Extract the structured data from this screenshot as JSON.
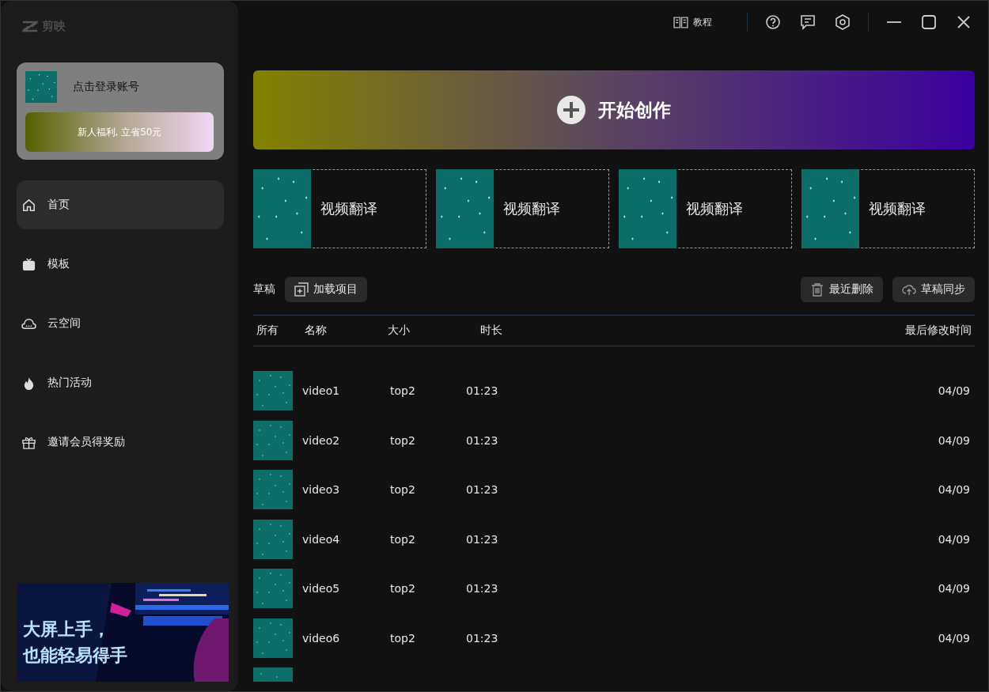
{
  "logo": {
    "text": "剪映"
  },
  "account": {
    "label": "点击登录账号",
    "promo": "新人福利, 立省50元"
  },
  "nav": [
    {
      "label": "首页",
      "selected": true
    },
    {
      "label": "模板",
      "selected": false
    },
    {
      "label": "云空间",
      "selected": false
    },
    {
      "label": "热门活动",
      "selected": false
    },
    {
      "label": "邀请会员得奖励",
      "selected": false
    }
  ],
  "banner": {
    "lines": [
      "大屏上手，",
      "也能轻易得手"
    ]
  },
  "topbar": {
    "tutorial": "教程"
  },
  "create": {
    "label": "开始创作"
  },
  "tools": [
    {
      "label": "视频翻译"
    },
    {
      "label": "视频翻译"
    },
    {
      "label": "视频翻译"
    },
    {
      "label": "视频翻译"
    }
  ],
  "drafts": {
    "title": "草稿",
    "load": "加载项目",
    "recent_deleted": "最近删除",
    "sync": "草稿同步"
  },
  "table": {
    "columns": [
      "所有",
      "名称",
      "大小",
      "时长",
      "最后修改时间"
    ],
    "rows": [
      {
        "kind": "full",
        "name": "video1",
        "size": "top2",
        "duration": "01:23",
        "modified": "04/09"
      },
      {
        "kind": "full",
        "name": "video2",
        "size": "top2",
        "duration": "01:23",
        "modified": "04/09"
      },
      {
        "kind": "full",
        "name": "video3",
        "size": "top2",
        "duration": "01:23",
        "modified": "04/09"
      },
      {
        "kind": "full",
        "name": "video4",
        "size": "top2",
        "duration": "01:23",
        "modified": "04/09"
      },
      {
        "kind": "full",
        "name": "video5",
        "size": "top2",
        "duration": "01:23",
        "modified": "04/09"
      },
      {
        "kind": "full",
        "name": "video6",
        "size": "top2",
        "duration": "01:23",
        "modified": "04/09"
      },
      {
        "kind": "clipped"
      }
    ]
  }
}
